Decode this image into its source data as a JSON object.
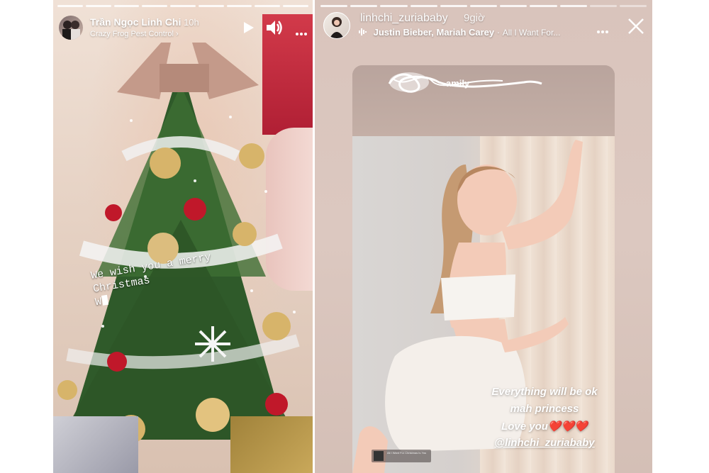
{
  "left_story": {
    "username": "Trần Ngọc Linh Chi",
    "time": "10h",
    "subtitle": "Crazy Frog Pest Control",
    "subtitle_chevron": "›",
    "sticker_lines": [
      "We wish you a merry",
      "Christmas",
      "W"
    ],
    "progress_total": 9,
    "progress_viewed": 9
  },
  "right_story": {
    "username": "linhchi_zuriababy",
    "time": "9giờ",
    "music_artist": "Justin Bieber, Mariah Carey",
    "music_track": "All I Want For...",
    "repost_handle_fragment": "amily",
    "caption_lines": [
      "Everything will be ok",
      "mah princess",
      "Love you❤️❤️❤️",
      "@linhchi_zuriababy"
    ],
    "music_tile_text": "All I Want For Christmas Is You"
  },
  "icons": {
    "play": "play-icon",
    "volume": "volume-icon",
    "more": "more-icon",
    "close": "close-icon",
    "music": "music-wave-icon"
  },
  "colors": {
    "wall_red": "#c62a3e",
    "caption_text": "#ffffff"
  }
}
